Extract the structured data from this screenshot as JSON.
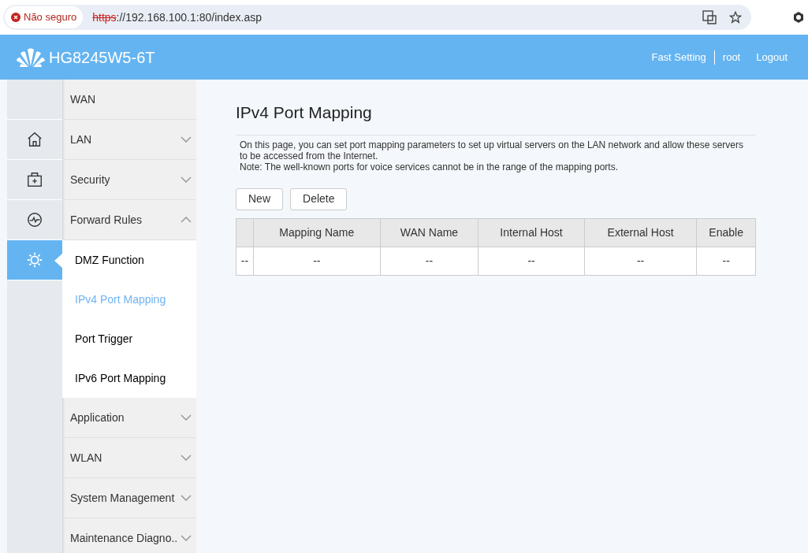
{
  "browser": {
    "security_label": "Não seguro",
    "url_scheme": "https",
    "url_rest": "://192.168.100.1:80/index.asp"
  },
  "header": {
    "product": "HG8245W5-6T",
    "links": [
      "Fast Setting",
      "root",
      "Logout"
    ]
  },
  "icon_rail": [
    {
      "selected": false
    },
    {
      "selected": false
    },
    {
      "selected": false
    },
    {
      "selected": false
    },
    {
      "selected": true
    }
  ],
  "menu": [
    {
      "kind": "link",
      "label": "WAN"
    },
    {
      "kind": "group",
      "label": "LAN",
      "expanded": false
    },
    {
      "kind": "group",
      "label": "Security",
      "expanded": false
    },
    {
      "kind": "group",
      "label": "Forward Rules",
      "expanded": true,
      "children": [
        {
          "label": "DMZ Function",
          "selected": false
        },
        {
          "label": "IPv4 Port Mapping",
          "selected": true
        },
        {
          "label": "Port Trigger",
          "selected": false
        },
        {
          "label": "IPv6 Port Mapping",
          "selected": false
        }
      ]
    },
    {
      "kind": "group",
      "label": "Application",
      "expanded": false
    },
    {
      "kind": "group",
      "label": "WLAN",
      "expanded": false
    },
    {
      "kind": "group",
      "label": "System Management",
      "expanded": false
    },
    {
      "kind": "group",
      "label": "Maintenance Diagno..",
      "expanded": false
    }
  ],
  "page": {
    "title": "IPv4 Port Mapping",
    "description": "On this page, you can set port mapping parameters to set up virtual servers on the LAN network and allow these servers to be accessed from the Internet.",
    "note": "Note: The well-known ports for voice services cannot be in the range of the mapping ports.",
    "buttons": [
      "New",
      "Delete"
    ],
    "table": {
      "columns": [
        "",
        "Mapping Name",
        "WAN Name",
        "Internal Host",
        "External Host",
        "Enable"
      ],
      "rows": [
        [
          "--",
          "--",
          "--",
          "--",
          "--",
          "--"
        ]
      ]
    }
  }
}
